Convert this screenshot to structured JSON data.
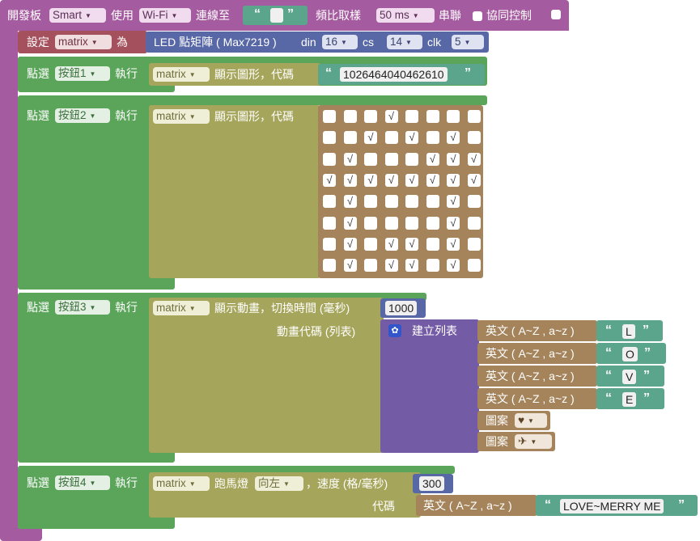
{
  "top": {
    "label_board": "開發板",
    "board": "Smart",
    "label_use": "使用",
    "network": "Wi-Fi",
    "label_connect": "連線至",
    "label_freq": "頻比取樣",
    "sample": "50 ms",
    "label_serial": "串聯",
    "label_sync": "協同控制"
  },
  "setup": {
    "label_set": "設定",
    "var": "matrix",
    "label_as": "為",
    "device": "LED 點矩陣 ( Max7219 )",
    "label_din": "din",
    "din": "16",
    "label_cs": "cs",
    "cs": "14",
    "label_clk": "clk",
    "clk": "5"
  },
  "events": [
    {
      "label_click": "點選",
      "button": "按鈕1",
      "label_do": "執行"
    },
    {
      "label_click": "點選",
      "button": "按鈕2",
      "label_do": "執行"
    },
    {
      "label_click": "點選",
      "button": "按鈕3",
      "label_do": "執行"
    },
    {
      "label_click": "點選",
      "button": "按鈕4",
      "label_do": "執行"
    }
  ],
  "b1": {
    "var": "matrix",
    "action": "顯示圖形，代碼",
    "code": "1026464040462610"
  },
  "b2": {
    "var": "matrix",
    "action": "顯示圖形，代碼",
    "grid": [
      [
        0,
        0,
        0,
        1,
        0,
        0,
        0,
        0
      ],
      [
        0,
        0,
        1,
        0,
        1,
        0,
        1,
        0
      ],
      [
        0,
        1,
        0,
        0,
        0,
        1,
        1,
        1
      ],
      [
        1,
        1,
        1,
        1,
        1,
        1,
        1,
        1
      ],
      [
        0,
        1,
        0,
        0,
        0,
        0,
        1,
        0
      ],
      [
        0,
        1,
        0,
        0,
        0,
        0,
        1,
        0
      ],
      [
        0,
        1,
        0,
        1,
        1,
        0,
        1,
        0
      ],
      [
        0,
        1,
        0,
        1,
        1,
        0,
        1,
        0
      ]
    ],
    "check": "√"
  },
  "b3": {
    "var": "matrix",
    "action": "顯示動畫，切換時間 (毫秒)",
    "interval": "1000",
    "label_codes": "動畫代碼 (列表)",
    "label_list": "建立列表",
    "items": [
      {
        "label": "英文 ( A~Z , a~z )",
        "value": "L"
      },
      {
        "label": "英文 ( A~Z , a~z )",
        "value": "O"
      },
      {
        "label": "英文 ( A~Z , a~z )",
        "value": "V"
      },
      {
        "label": "英文 ( A~Z , a~z )",
        "value": "E"
      }
    ],
    "patterns": [
      {
        "label": "圖案",
        "value": "♥"
      },
      {
        "label": "圖案",
        "value": "✈"
      }
    ]
  },
  "b4": {
    "var": "matrix",
    "action": "跑馬燈",
    "direction": "向左",
    "label_speed": "，速度 (格/毫秒)",
    "speed": "300",
    "label_code": "代碼",
    "label_english": "英文 ( A~Z , a~z )",
    "text": "LOVE~MERRY ME"
  },
  "arrow": "▼",
  "quote_open": "“",
  "quote_close": "”",
  "colors": {
    "board": "#a55b9f",
    "setup": "#a5505d",
    "device": "#5867a5",
    "event": "#5ba55b",
    "matrix": "#a5a55b",
    "text": "#a5845b",
    "list": "#745ba5",
    "string": "#5ba58c"
  }
}
